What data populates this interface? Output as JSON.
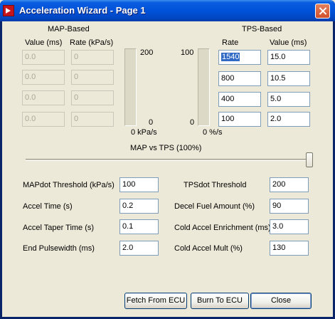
{
  "window": {
    "title": "Acceleration Wizard - Page 1"
  },
  "map": {
    "heading": "MAP-Based",
    "col_value": "Value (ms)",
    "col_rate": "Rate (kPa/s)",
    "rows": [
      {
        "value": "0.0",
        "rate": "0"
      },
      {
        "value": "0.0",
        "rate": "0"
      },
      {
        "value": "0.0",
        "rate": "0"
      },
      {
        "value": "0.0",
        "rate": "0"
      }
    ],
    "bar_max": "200",
    "bar_min": "0",
    "bar_unit": "0 kPa/s",
    "bar_level": 0
  },
  "tps": {
    "heading": "TPS-Based",
    "col_rate": "Rate",
    "col_value": "Value (ms)",
    "rows": [
      {
        "rate": "1540",
        "value": "15.0"
      },
      {
        "rate": "800",
        "value": "10.5"
      },
      {
        "rate": "400",
        "value": "5.0"
      },
      {
        "rate": "100",
        "value": "2.0"
      }
    ],
    "bar_max": "100",
    "bar_min": "0",
    "bar_unit": "0 %/s",
    "bar_level": 0
  },
  "slider": {
    "label": "MAP vs TPS (100%)",
    "value_pct": 100
  },
  "params_left": [
    {
      "label": "MAPdot Threshold (kPa/s)",
      "value": "100"
    },
    {
      "label": "Accel Time (s)",
      "value": "0.2"
    },
    {
      "label": "Accel Taper Time (s)",
      "value": "0.1"
    },
    {
      "label": "End Pulsewidth (ms)",
      "value": "2.0"
    }
  ],
  "params_right": [
    {
      "label": "TPSdot Threshold",
      "value": "200"
    },
    {
      "label": "Decel Fuel Amount (%)",
      "value": "90"
    },
    {
      "label": "Cold Accel Enrichment (ms)",
      "value": "3.0"
    },
    {
      "label": "Cold Accel Mult (%)",
      "value": "130"
    }
  ],
  "buttons": {
    "fetch": "Fetch From ECU",
    "burn": "Burn To ECU",
    "close": "Close"
  }
}
